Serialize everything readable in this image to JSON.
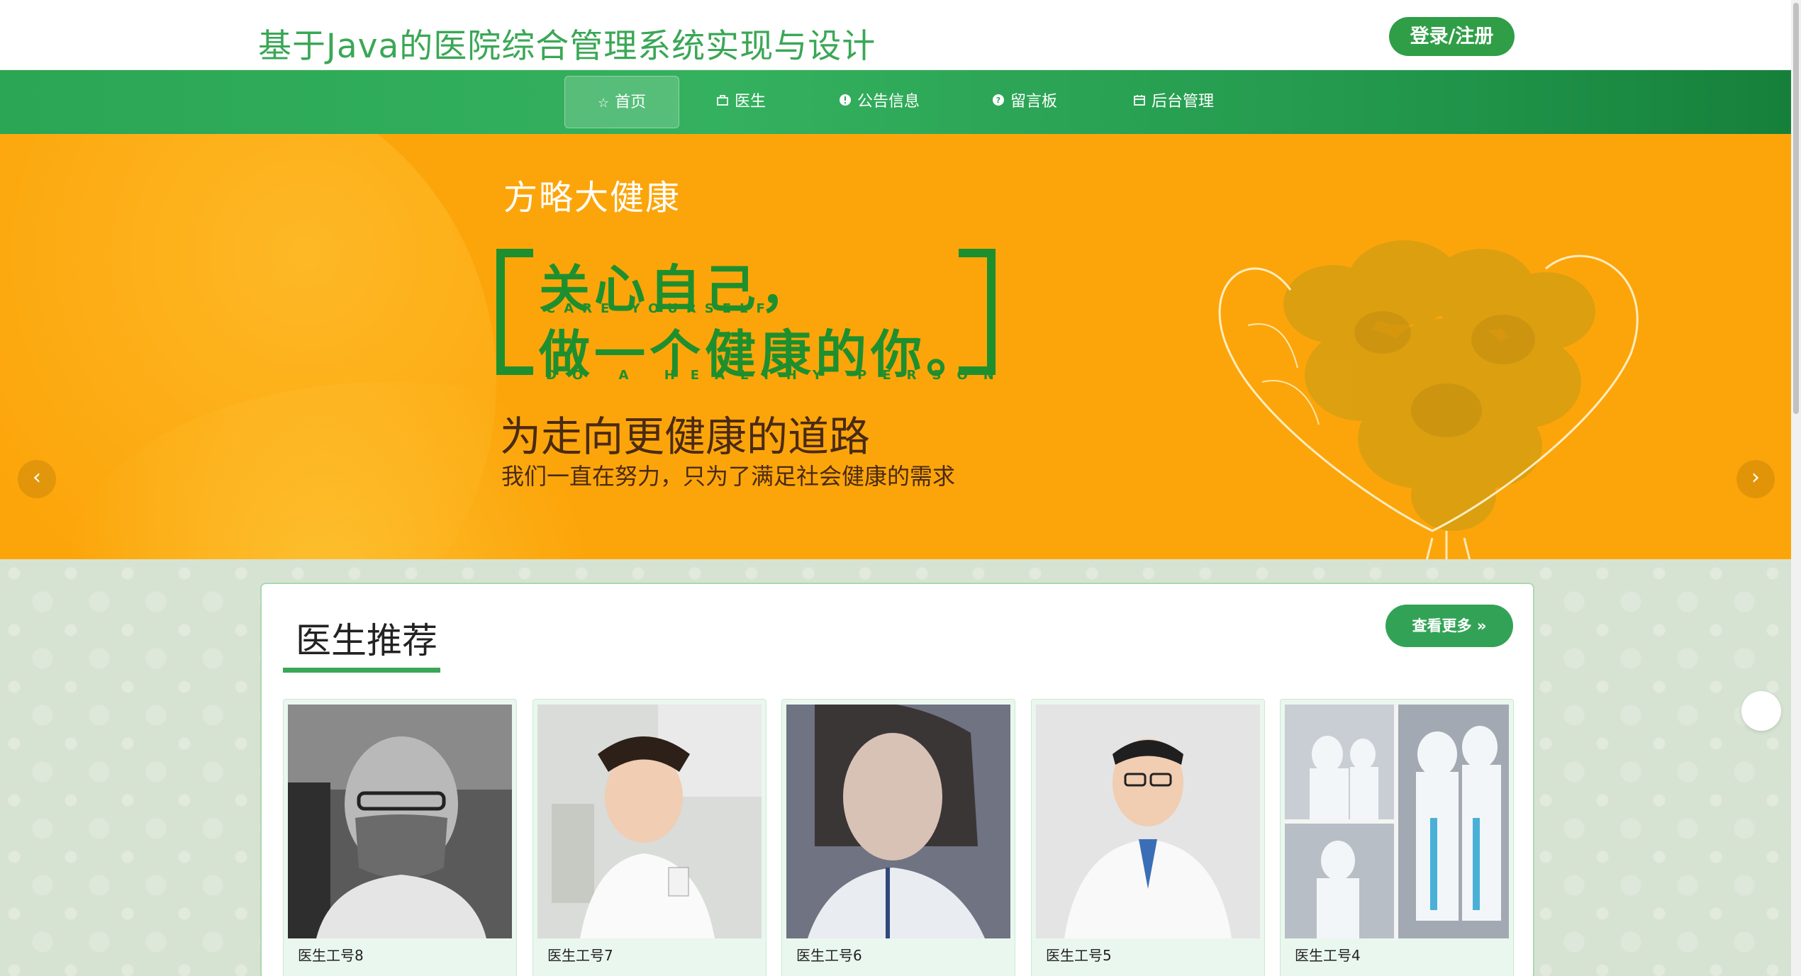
{
  "header": {
    "title": "基于Java的医院综合管理系统实现与设计",
    "login_label": "登录/注册"
  },
  "nav": {
    "items": [
      {
        "label": "首页",
        "icon": "star-icon",
        "active": true
      },
      {
        "label": "医生",
        "icon": "bag-icon"
      },
      {
        "label": "公告信息",
        "icon": "alert-circle-icon"
      },
      {
        "label": "留言板",
        "icon": "help-circle-icon"
      },
      {
        "label": "后台管理",
        "icon": "calendar-box-icon"
      }
    ]
  },
  "banner": {
    "kicker": "方略大健康",
    "line1": "关心自己，",
    "line1_en": "CARE YOURSELF",
    "line2": "做一个健康的你。",
    "line2_en": "DO A HEALTHY PERSON",
    "headline": "为走向更健康的道路",
    "sub": "我们一直在努力，只为了满足社会健康的需求",
    "slide_count": 3,
    "active_slide": 3
  },
  "doctors_section": {
    "title": "医生推荐",
    "more_label": "查看更多",
    "cards": [
      {
        "caption": "医生工号8"
      },
      {
        "caption": "医生工号7"
      },
      {
        "caption": "医生工号6"
      },
      {
        "caption": "医生工号5"
      },
      {
        "caption": "医生工号4"
      }
    ]
  },
  "colors": {
    "brand_green": "#3aa756",
    "banner_orange": "#fca50a",
    "banner_text_green": "#1e8f2e"
  }
}
